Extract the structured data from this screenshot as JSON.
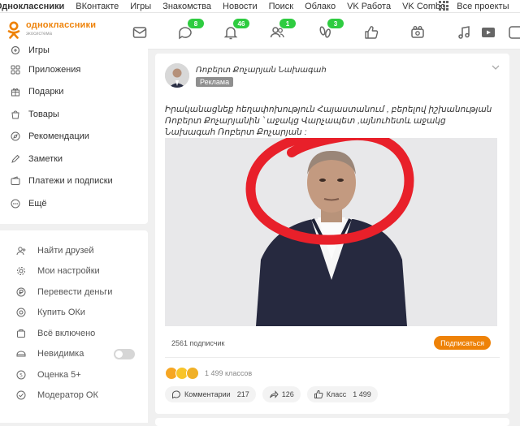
{
  "topnav": {
    "links": [
      "Одноклассники",
      "ВКонтакте",
      "Игры",
      "Знакомства",
      "Новости",
      "Поиск",
      "Облако",
      "VK Работа",
      "VK Combo",
      "Все проекты"
    ]
  },
  "header": {
    "logo_title": "одноклассники",
    "logo_subtitle": "экосистема",
    "badges": {
      "discussions": "8",
      "notifications": "46",
      "friends": "1",
      "guests": "3"
    }
  },
  "sidebar": {
    "items": [
      "Игры",
      "Приложения",
      "Подарки",
      "Товары",
      "Рекомендации",
      "Заметки",
      "Платежи и подписки",
      "Ещё"
    ],
    "tools": [
      "Найти друзей",
      "Мои настройки",
      "Перевести деньги",
      "Купить ОКи",
      "Всё включено",
      "Невидимка",
      "Оценка 5+",
      "Модератор ОК"
    ]
  },
  "post": {
    "author": "Ռոբերտ Քոչարյան Նախագահ",
    "ad_label": "Реклама",
    "text": "Իրականացնեք հեղափոխություն Հայաստանում , բերելով իշխանության Ռոբերտ Քոչարյանին ՝ աջակց Վարչապետ ,այնուհետև աջակց Նախագահ Ռոբերտ Քոչարյան :",
    "subscribers": "2561 подписчик",
    "subscribe_label": "Подписаться",
    "reactions_count": "1 499 классов",
    "comments_label": "Комментарии",
    "comments_count": "217",
    "shares_count": "126",
    "likes_label": "Класс",
    "likes_count": "1 499"
  },
  "colors": {
    "accent": "#ee8208",
    "badge": "#2ecc40",
    "annotation": "#e8202a"
  }
}
